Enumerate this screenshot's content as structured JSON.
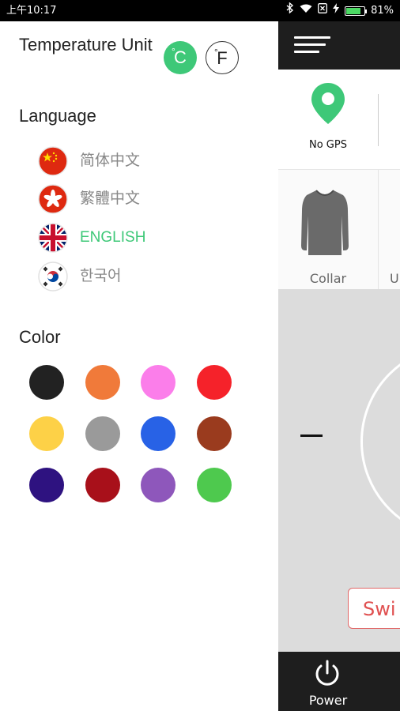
{
  "status_bar": {
    "time": "上午10:17",
    "battery": "81%",
    "battery_level": 0.81
  },
  "drawer": {
    "temperature_unit": {
      "title": "Temperature Unit",
      "celsius": "C",
      "fahrenheit": "F",
      "selected": "C",
      "degree_symbol": "°"
    },
    "language": {
      "title": "Language",
      "items": [
        {
          "label": "简体中文",
          "flag": "china-flag-icon",
          "active": false
        },
        {
          "label": "繁體中文",
          "flag": "hong-kong-flag-icon",
          "active": false
        },
        {
          "label": "ENGLISH",
          "flag": "uk-flag-icon",
          "active": true
        },
        {
          "label": "한국어",
          "flag": "korea-flag-icon",
          "active": false
        }
      ]
    },
    "color": {
      "title": "Color",
      "swatches": [
        "#222222",
        "#F07A3A",
        "#FB7EEA",
        "#F5222A",
        "#FDD147",
        "#9A9A9A",
        "#2862E6",
        "#9A3B1E",
        "#2E1280",
        "#A8101A",
        "#8E57BB",
        "#4EC94E"
      ]
    }
  },
  "app": {
    "gps_label": "No GPS",
    "garments": [
      "Collar",
      "U"
    ],
    "switch_label": "Swi",
    "power_label": "Power",
    "accent_color": "#3EC878"
  }
}
